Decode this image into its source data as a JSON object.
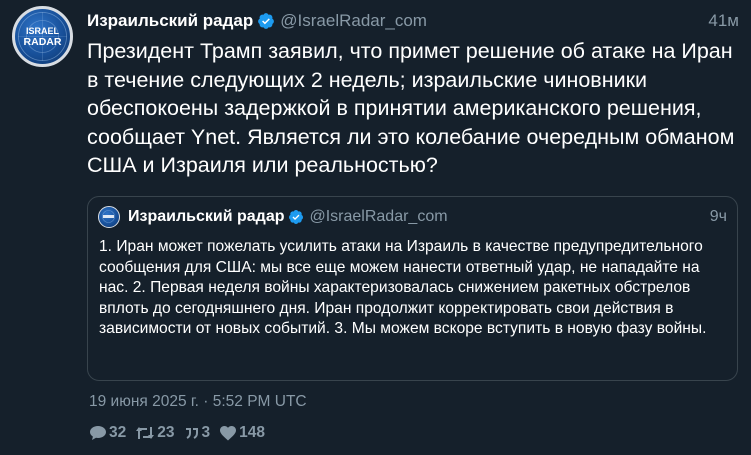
{
  "author": {
    "display_name": "Израильский радар",
    "handle": "@IsraelRadar_com",
    "avatar_text_line1": "ISRAEL",
    "avatar_text_line2": "RADAR",
    "verified": true
  },
  "tweet": {
    "time_ago": "41м",
    "text": "Президент Трамп заявил, что примет решение об атаке на Иран в течение следующих 2 недель; израильские чиновники обеспокоены задержкой в принятии американского решения, сообщает Ynet. Является ли это колебание очередным обманом США и Израиля или реальностью?",
    "date": "19 июня 2025 г. · 5:52 PM UTC"
  },
  "quoted_tweet": {
    "display_name": "Израильский радар",
    "handle": "@IsraelRadar_com",
    "time_ago": "9ч",
    "text": "1. Иран может пожелать усилить атаки на Израиль в качестве предупредительного сообщения для США: мы все еще можем нанести ответный удар, не нападайте на нас. 2. Первая неделя войны характеризовалась снижением ракетных обстрелов вплоть до сегодняшнего дня. Иран продолжит корректировать свои действия в зависимости от новых событий. 3. Мы можем вскоре вступить в новую фазу войны."
  },
  "stats": {
    "replies": "32",
    "retweets": "23",
    "quotes": "3",
    "likes": "148"
  },
  "icons": {
    "reply": "comment-icon",
    "retweet": "retweet-icon",
    "quote": "quote-icon",
    "like": "heart-icon",
    "verified": "verified-badge-icon"
  },
  "colors": {
    "background": "#15202b",
    "text": "#ffffff",
    "muted": "#8899a6",
    "verified": "#1d9bf0",
    "border": "#38444d"
  }
}
